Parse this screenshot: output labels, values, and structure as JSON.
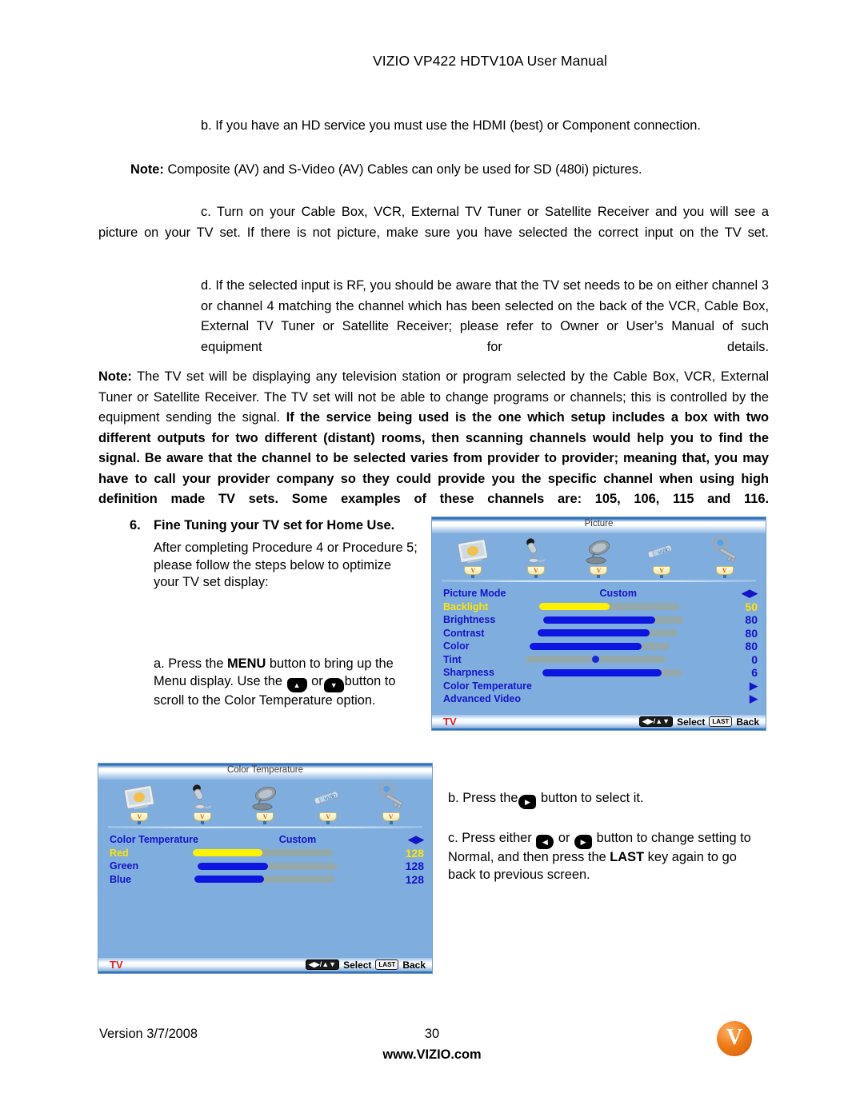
{
  "header": {
    "title": "VIZIO VP422 HDTV10A User Manual"
  },
  "body": {
    "step_b_hd": "b. If you have an HD service you must use the HDMI (best) or Component connection.",
    "note1_label": "Note:",
    "note1_text": "Composite (AV) and S-Video (AV) Cables can only be used for SD (480i) pictures.",
    "step_c": "c. Turn on your Cable Box, VCR, External TV Tuner or Satellite Receiver and you will see a picture on your TV set. If there is not picture, make sure you have selected the correct input on the TV set.",
    "step_d": "d. If the selected input is RF, you should be aware that the TV set needs to be on either channel 3 or channel 4 matching the channel which has been selected on the back of the VCR, Cable Box, External TV Tuner or Satellite Receiver; please refer to Owner or User’s Manual of such equipment for details.",
    "note2_label": "Note:",
    "note2_normal": "The TV set will be displaying any television station or program selected by the Cable Box, VCR, External Tuner or Satellite Receiver. The TV set will not be able to change programs or channels; this is controlled by the equipment sending the signal.",
    "note2_bold": "If the service being used is the one which setup includes a box with two different outputs for two different (distant) rooms, then scanning channels would help you to find the signal. Be aware that the channel to be selected varies from provider to provider; meaning that, you may have to call your provider company so they could provide you the specific channel when using high definition made TV sets. Some examples of these channels are: 105, 106, 115 and 116."
  },
  "section6": {
    "number": "6.",
    "title": "Fine Tuning your TV set for Home Use.",
    "intro": "After completing Procedure 4 or Procedure 5; please follow the steps below to optimize your TV set display:",
    "step_a_part1": "a. Press the",
    "step_a_menu": "MENU",
    "step_a_part2": "button to bring up the Menu display. Use the",
    "step_a_or": "or",
    "step_a_part3": "button to scroll to the Color Temperature option.",
    "step_b_part1": "b. Press the",
    "step_b_part2": "button to select it.",
    "step_c_part1": "c. Press either",
    "step_c_or": "or",
    "step_c_part2": "button to change setting to Normal, and then press the",
    "step_c_last": "LAST",
    "step_c_part3": "key again to go back to previous screen.",
    "key_up": "▲",
    "key_down": "▼",
    "key_left": "◀",
    "key_right": "▶"
  },
  "osd_picture": {
    "title": "Picture",
    "icons": [
      "tv-picture-icon",
      "microphone-icon",
      "satellite-dish-icon",
      "wrench-icon",
      "key-icon"
    ],
    "badge_text": "V",
    "rows": [
      {
        "label": "Picture Mode",
        "type": "option",
        "value": "Custom",
        "arrow": "◀▶",
        "selected": false
      },
      {
        "label": "Backlight",
        "type": "slider",
        "value": "50",
        "fill_pct": 50,
        "fill_color": "yellow",
        "selected": true
      },
      {
        "label": "Brightness",
        "type": "slider",
        "value": "80",
        "fill_pct": 80,
        "fill_color": "blue",
        "selected": false
      },
      {
        "label": "Contrast",
        "type": "slider",
        "value": "80",
        "fill_pct": 80,
        "fill_color": "blue",
        "selected": false
      },
      {
        "label": "Color",
        "type": "slider",
        "value": "80",
        "fill_pct": 80,
        "fill_color": "blue",
        "selected": false
      },
      {
        "label": "Tint",
        "type": "knob",
        "value": "0",
        "fill_pct": 50,
        "selected": false
      },
      {
        "label": "Sharpness",
        "type": "slider",
        "value": "6",
        "fill_pct": 85,
        "fill_color": "blue",
        "selected": false
      },
      {
        "label": "Color Temperature",
        "type": "submenu",
        "value": "",
        "arrow": "▶",
        "selected": false
      },
      {
        "label": "Advanced Video",
        "type": "submenu",
        "value": "",
        "arrow": "▶",
        "selected": false
      }
    ],
    "bottom": {
      "tv": "TV",
      "nav_keys": "◀▶/▲▼",
      "select": "Select",
      "last_key": "LAST",
      "back": "Back"
    }
  },
  "osd_colortemp": {
    "title": "Color Temperature",
    "icons": [
      "tv-picture-icon",
      "microphone-icon",
      "satellite-dish-icon",
      "wrench-icon",
      "key-icon"
    ],
    "badge_text": "V",
    "rows": [
      {
        "label": "Color Temperature",
        "type": "option",
        "value": "Custom",
        "arrow": "◀▶",
        "selected": false
      },
      {
        "label": "Red",
        "type": "slider",
        "value": "128",
        "fill_pct": 50,
        "fill_color": "yellow",
        "selected": true
      },
      {
        "label": "Green",
        "type": "slider",
        "value": "128",
        "fill_pct": 50,
        "fill_color": "blue",
        "selected": false
      },
      {
        "label": "Blue",
        "type": "slider",
        "value": "128",
        "fill_pct": 50,
        "fill_color": "blue",
        "selected": false
      }
    ],
    "bottom": {
      "tv": "TV",
      "nav_keys": "◀▶/▲▼",
      "select": "Select",
      "last_key": "LAST",
      "back": "Back"
    }
  },
  "footer": {
    "version": "Version 3/7/2008",
    "page": "30",
    "url": "www.VIZIO.com",
    "logo_letter": "V"
  }
}
